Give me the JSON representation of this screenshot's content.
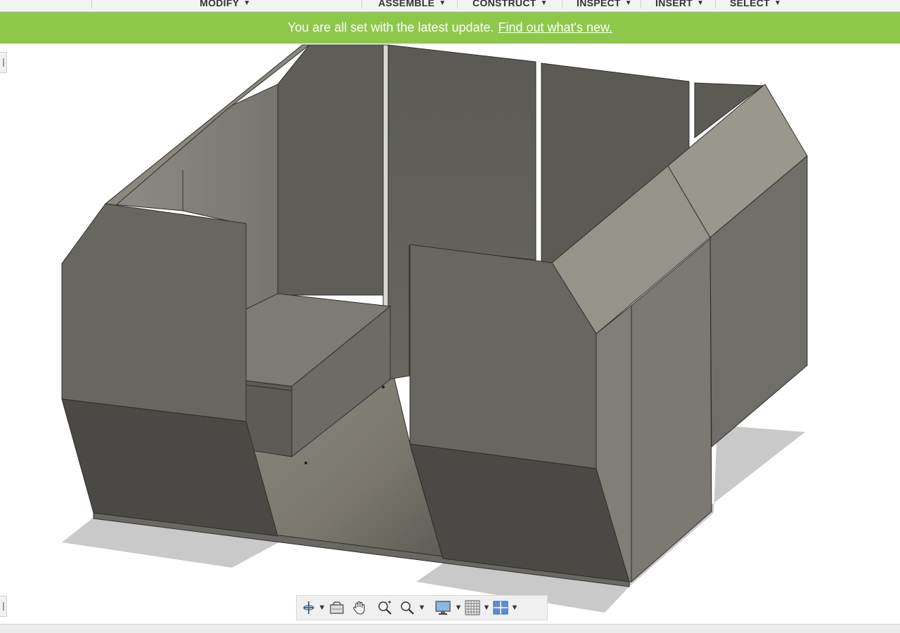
{
  "toolbar": {
    "menus": [
      {
        "label": "MODIFY"
      },
      {
        "label": "ASSEMBLE"
      },
      {
        "label": "CONSTRUCT"
      },
      {
        "label": "INSPECT"
      },
      {
        "label": "INSERT"
      },
      {
        "label": "SELECT"
      }
    ]
  },
  "banner": {
    "message": "You are all set with the latest update.",
    "link": "Find out what's new.",
    "color": "#8dc84b"
  },
  "navbar": {
    "tools": [
      "orbit-icon",
      "look-at-icon",
      "pan-icon",
      "zoom-icon",
      "fit-icon",
      "display-settings-icon",
      "grid-icon",
      "viewports-icon"
    ]
  },
  "colors": {
    "panel_dark": "#55544f",
    "panel_mid": "#6e6d67",
    "panel_light": "#9a9890",
    "floor": "#7a7870"
  }
}
